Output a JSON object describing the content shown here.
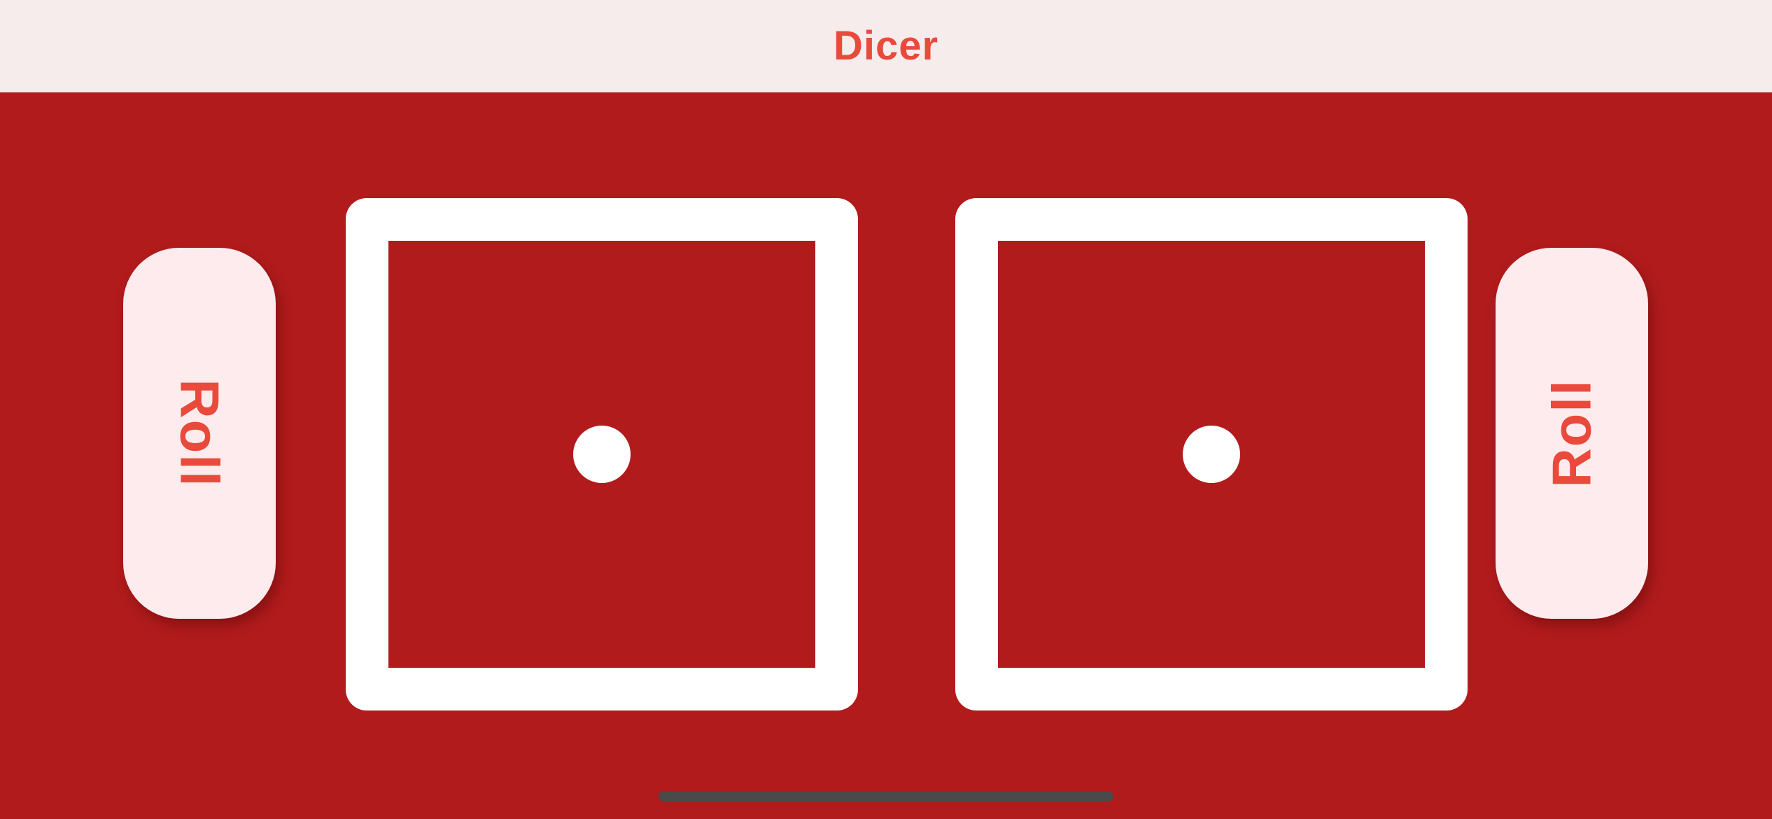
{
  "header": {
    "title": "Dicer",
    "background_color": "#f6ecec",
    "title_color": "#ea4a3c"
  },
  "main": {
    "background_color": "#b21b1c",
    "left_button": {
      "label": "Roll"
    },
    "right_button": {
      "label": "Roll"
    },
    "dice": [
      {
        "value": 1,
        "face_color": "#b21b1c",
        "frame_color": "#ffffff"
      },
      {
        "value": 1,
        "face_color": "#b21b1c",
        "frame_color": "#ffffff"
      }
    ]
  }
}
